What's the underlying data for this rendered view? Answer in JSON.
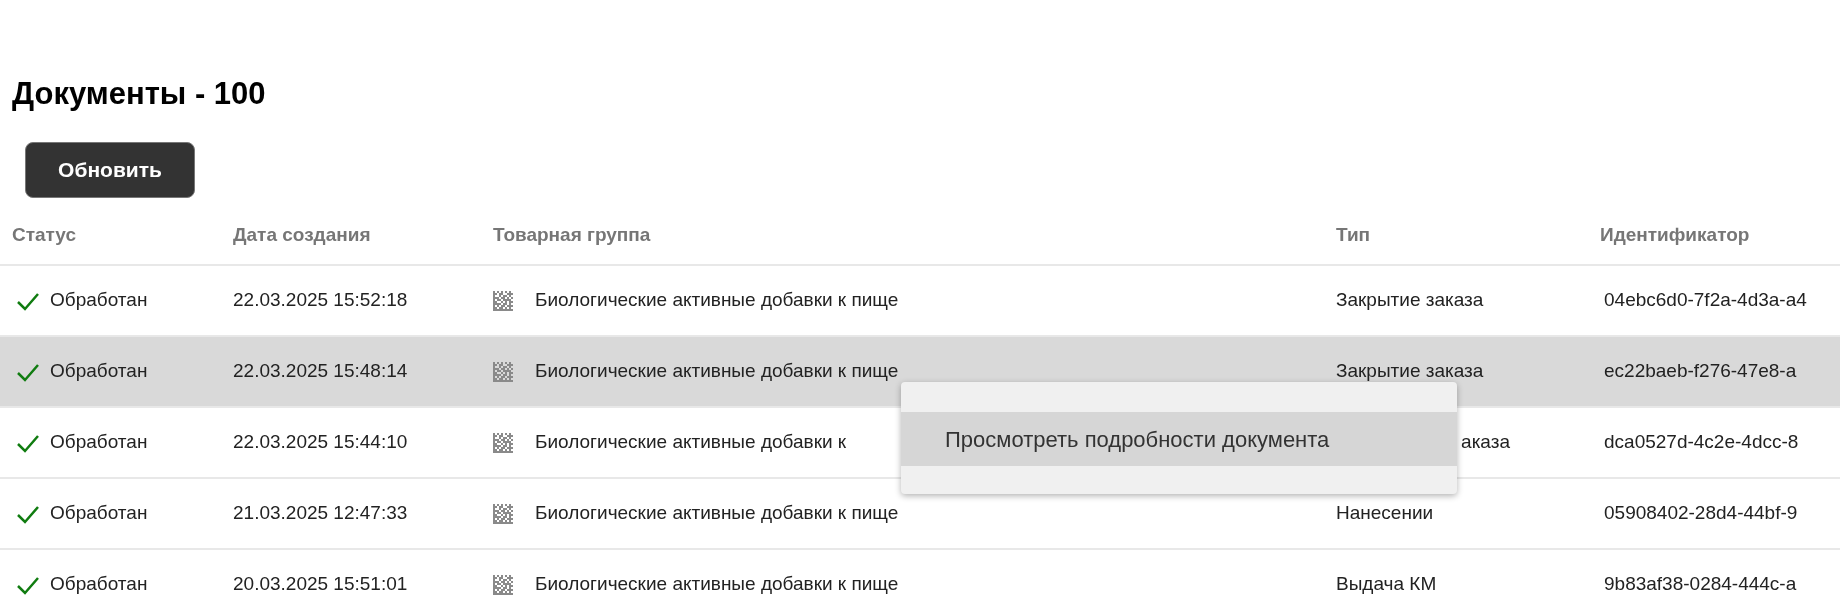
{
  "title": "Документы - 100",
  "refresh_button": "Обновить",
  "table": {
    "columns": [
      "Статус",
      "Дата создания",
      "Товарная группа",
      "Тип",
      "Идентификатор"
    ],
    "rows": [
      {
        "status": "Обработан",
        "done": true,
        "date": "22.03.2025 15:52:18",
        "group": "Биологические активные добавки к пище",
        "type": "Закрытие заказа",
        "id": "04ebc6d0-7f2a-4d3a-a4",
        "selected": false
      },
      {
        "status": "Обработан",
        "done": true,
        "date": "22.03.2025 15:48:14",
        "group": "Биологические активные добавки к пище",
        "type": "Закрытие заказа",
        "id": "ec22baeb-f276-47e8-a",
        "selected": true,
        "menu_open": true
      },
      {
        "status": "Обработан",
        "done": true,
        "date": "22.03.2025 15:44:10",
        "group": "Биологические активные добавки к",
        "type": "аказа",
        "id": "dca0527d-4c2e-4dcc-8",
        "selected": false
      },
      {
        "status": "Обработан",
        "done": true,
        "date": "21.03.2025 12:47:33",
        "group": "Биологические активные добавки к пище",
        "type": "Нанесении",
        "id": "05908402-28d4-44bf-9",
        "selected": false
      },
      {
        "status": "Обработан",
        "done": true,
        "date": "20.03.2025 15:51:01",
        "group": "Биологические активные добавки к пище",
        "type": "Выдача КМ",
        "id": "9b83af38-0284-444c-a",
        "selected": false
      }
    ]
  },
  "context_menu": {
    "items": [
      {
        "label": "Просмотреть подробности документа",
        "selected": true
      }
    ]
  }
}
